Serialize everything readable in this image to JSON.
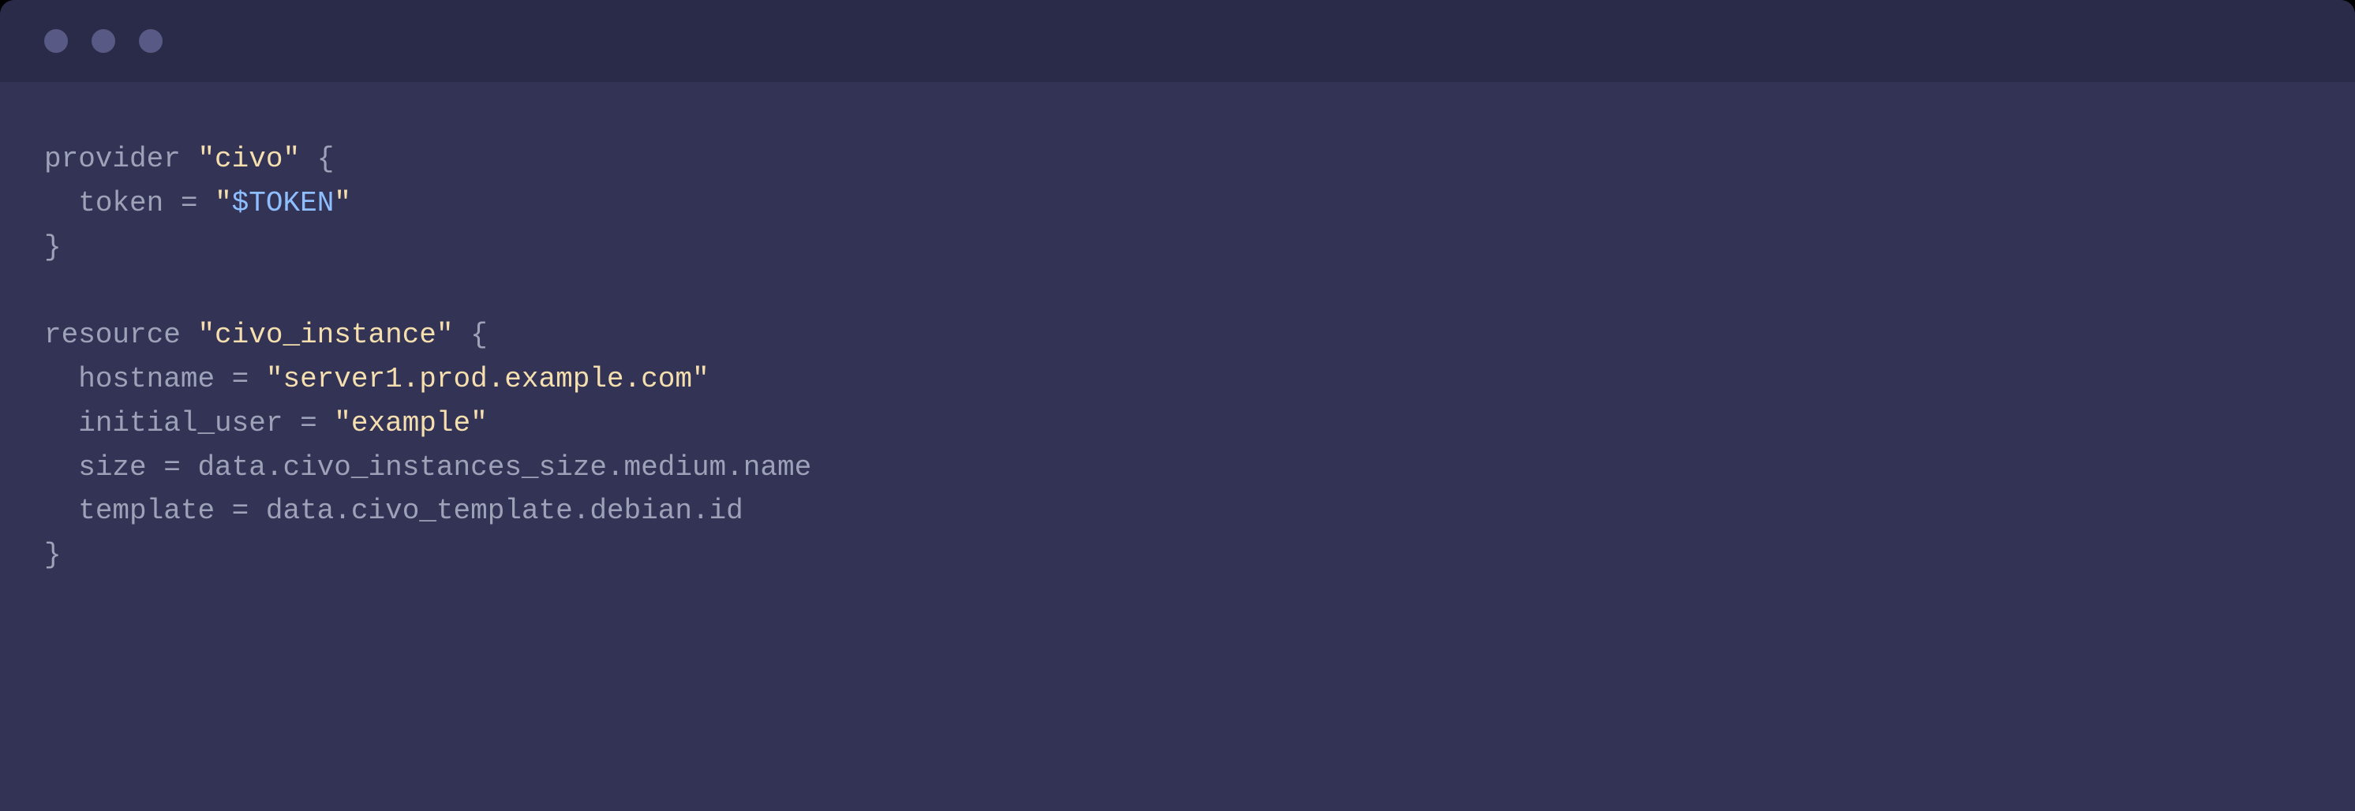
{
  "colors": {
    "titlebar": "#2a2b49",
    "body": "#333355",
    "dot": "#585a85",
    "muted": "#9ea2b8",
    "string": "#f5dfaf",
    "variable": "#8fbeff"
  },
  "code": {
    "provider_keyword": "provider",
    "provider_name_open": "\"",
    "provider_name": "civo",
    "provider_name_close": "\"",
    "brace_open": "{",
    "brace_close": "}",
    "token_attr": "token",
    "equals": " = ",
    "token_value_open": "\"",
    "token_value_var": "$TOKEN",
    "token_value_close": "\"",
    "resource_keyword": "resource",
    "resource_name_open": "\"",
    "resource_name": "civo_instance",
    "resource_name_close": "\"",
    "hostname_attr": "hostname",
    "hostname_value": "\"server1.prod.example.com\"",
    "initial_user_attr": "initial_user",
    "initial_user_value": "\"example\"",
    "size_attr": "size",
    "size_value": "data.civo_instances_size.medium.name",
    "template_attr": "template",
    "template_value": "data.civo_template.debian.id"
  }
}
